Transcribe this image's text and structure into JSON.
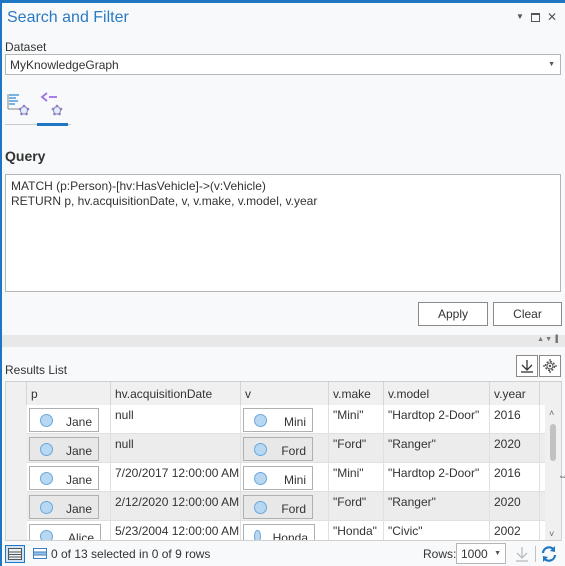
{
  "window": {
    "title": "Search and Filter",
    "controls": {
      "dropdown_icon": "pane-menu-icon",
      "maximize_icon": "maximize-icon",
      "close_icon": "close-icon"
    }
  },
  "dataset": {
    "label": "Dataset",
    "value": "MyKnowledgeGraph"
  },
  "tabs": [
    {
      "name": "search",
      "icon": "search-entities-icon",
      "selected": false
    },
    {
      "name": "query",
      "icon": "query-entities-icon",
      "selected": true
    }
  ],
  "query": {
    "heading": "Query",
    "text": "MATCH (p:Person)-[hv:HasVehicle]->(v:Vehicle)\nRETURN p, hv.acquisitionDate, v, v.make, v.model, v.year"
  },
  "buttons": {
    "apply": "Apply",
    "clear": "Clear"
  },
  "results": {
    "label": "Results List",
    "export_icon": "export-icon",
    "settings_icon": "gear-icon",
    "columns": [
      "p",
      "hv.acquisitionDate",
      "v",
      "v.make",
      "v.model",
      "v.year"
    ],
    "rows": [
      {
        "p": "Jane",
        "date": "null",
        "v": "Mini",
        "make": "\"Mini\"",
        "model": "\"Hardtop 2-Door\"",
        "year": "2016"
      },
      {
        "p": "Jane",
        "date": "null",
        "v": "Ford",
        "make": "\"Ford\"",
        "model": "\"Ranger\"",
        "year": "2020"
      },
      {
        "p": "Jane",
        "date": "7/20/2017 12:00:00 AM",
        "v": "Mini",
        "make": "\"Mini\"",
        "model": "\"Hardtop 2-Door\"",
        "year": "2016"
      },
      {
        "p": "Jane",
        "date": "2/12/2020 12:00:00 AM",
        "v": "Ford",
        "make": "\"Ford\"",
        "model": "\"Ranger\"",
        "year": "2020"
      },
      {
        "p": "Alice",
        "date": "5/23/2004 12:00:00 AM",
        "v": "Honda",
        "make": "\"Honda\"",
        "model": "\"Civic\"",
        "year": "2002"
      }
    ]
  },
  "status": {
    "selection": "0 of 13 selected in 0 of 9 rows",
    "rows_label": "Rows:",
    "rows_value": "1000"
  },
  "colors": {
    "accent": "#1f77c3",
    "title": "#2c7ac3",
    "entity_dot": "#b8d8f2"
  }
}
